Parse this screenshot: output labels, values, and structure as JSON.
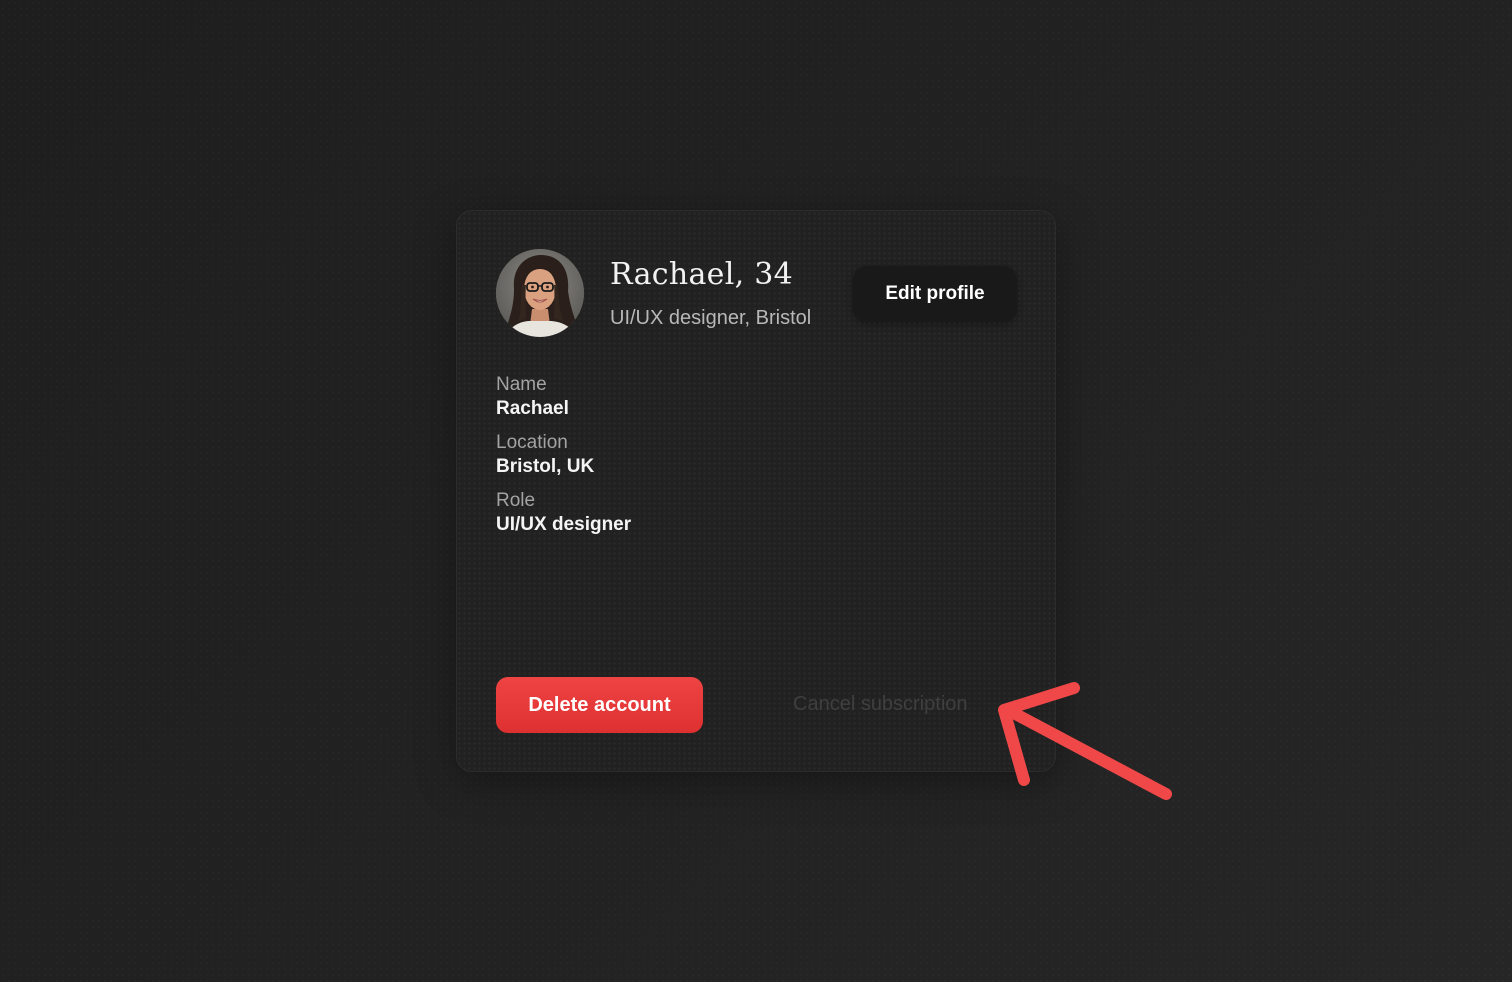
{
  "profile": {
    "title": "Rachael, 34",
    "subtitle": "UI/UX designer, Bristol",
    "edit_label": "Edit profile"
  },
  "fields": [
    {
      "label": "Name",
      "value": "Rachael"
    },
    {
      "label": "Location",
      "value": "Bristol, UK"
    },
    {
      "label": "Role",
      "value": "UI/UX designer"
    }
  ],
  "actions": {
    "delete_label": "Delete account",
    "cancel_label": "Cancel subscription"
  },
  "colors": {
    "background": "#222222",
    "card": "#212121",
    "danger": "#ef4444",
    "arrow": "#f04848"
  },
  "icons": {
    "avatar": "user-avatar-photo",
    "annotation": "red-arrow-icon"
  }
}
